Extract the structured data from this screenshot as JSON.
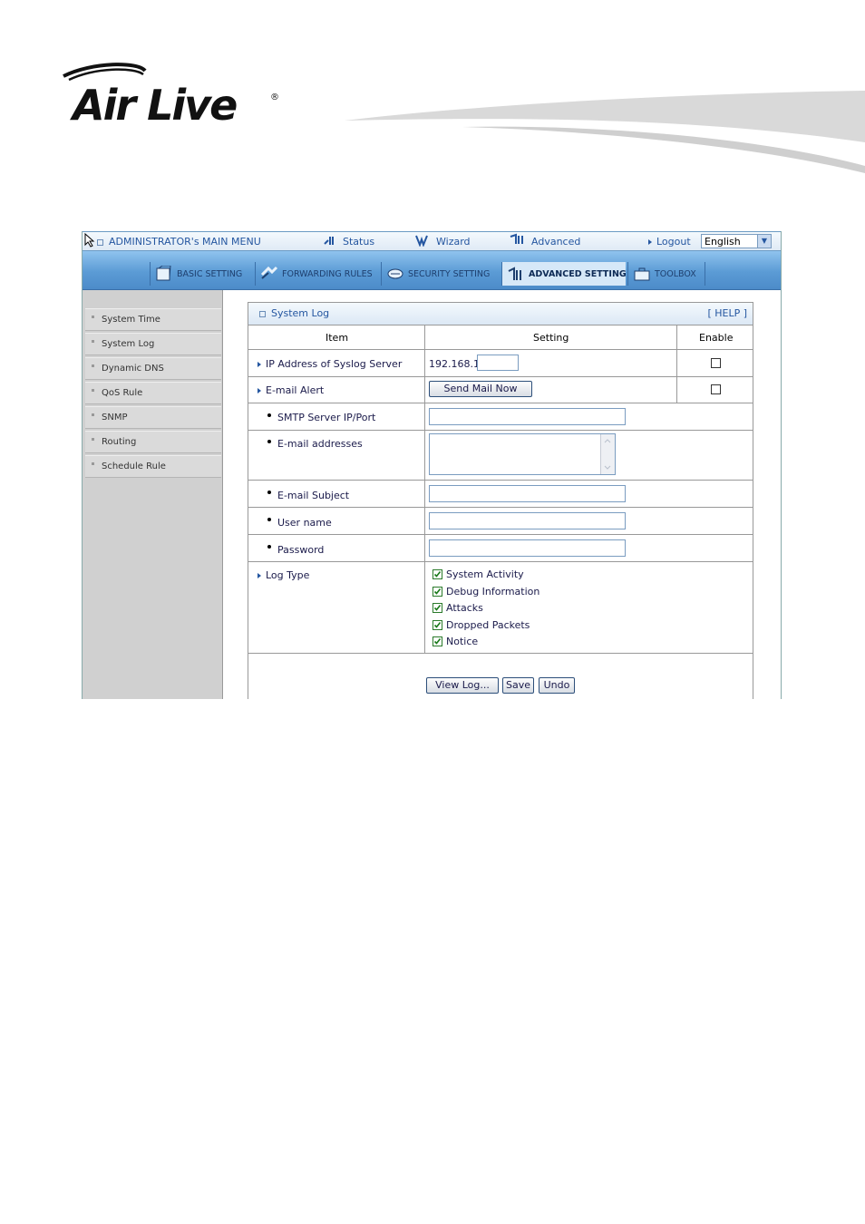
{
  "brand": {
    "logo_text": "Air Live",
    "registered": "®"
  },
  "menu": {
    "admin_label": "ADMINISTRATOR's MAIN MENU",
    "status": "Status",
    "wizard": "Wizard",
    "advanced": "Advanced",
    "logout": "Logout",
    "language": "English"
  },
  "tabs": [
    "BASIC SETTING",
    "FORWARDING RULES",
    "SECURITY SETTING",
    "ADVANCED SETTING",
    "TOOLBOX"
  ],
  "active_tab": "ADVANCED SETTING",
  "sidebar": [
    "System Time",
    "System Log",
    "Dynamic DNS",
    "QoS Rule",
    "SNMP",
    "Routing",
    "Schedule Rule"
  ],
  "panel": {
    "title": "System Log",
    "help": "[ HELP ]",
    "headers": {
      "item": "Item",
      "setting": "Setting",
      "enable": "Enable"
    },
    "syslog_label": "IP Address of Syslog Server",
    "syslog_prefix": "192.168.1.",
    "syslog_value": "",
    "syslog_enabled": false,
    "email_alert_label": "E-mail Alert",
    "send_mail_button": "Send Mail Now",
    "email_alert_enabled": false,
    "smtp_label": "SMTP Server IP/Port",
    "smtp_value": "",
    "email_addresses_label": "E-mail addresses",
    "email_subject_label": "E-mail Subject",
    "username_label": "User name",
    "password_label": "Password",
    "log_type_label": "Log Type",
    "log_types": [
      "System Activity",
      "Debug Information",
      "Attacks",
      "Dropped Packets",
      "Notice"
    ],
    "log_types_checked": [
      true,
      true,
      true,
      true,
      true
    ],
    "buttons": {
      "view_log": "View Log...",
      "save": "Save",
      "undo": "Undo"
    }
  },
  "colors": {
    "accent": "#2456a0",
    "tabbar": "#5b9bd5",
    "sidebar": "#d0d0d0"
  }
}
